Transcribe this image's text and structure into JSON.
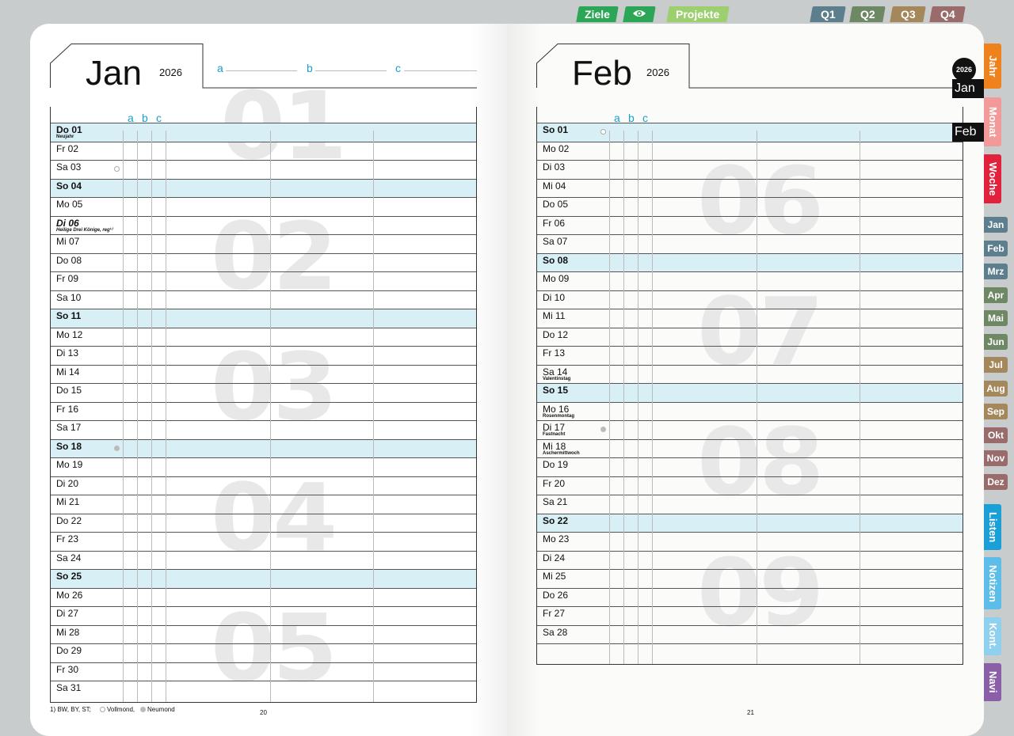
{
  "top_tabs": [
    {
      "label": "Ziele",
      "color": "#2aa656"
    },
    {
      "label": "",
      "icon": "eye-icon",
      "color": "#2aa656"
    },
    {
      "label": "Projekte",
      "color": "#9ccf6e"
    },
    {
      "label": "Q1",
      "color": "#5d7f8d"
    },
    {
      "label": "Q2",
      "color": "#6e8765"
    },
    {
      "label": "Q3",
      "color": "#a4875a"
    },
    {
      "label": "Q4",
      "color": "#9a6b6b"
    }
  ],
  "left": {
    "month": "Jan",
    "year": "2026",
    "abc": [
      "a",
      "b",
      "c"
    ],
    "columns": [
      "a",
      "b",
      "c"
    ],
    "week_numbers": [
      "01",
      "02",
      "03",
      "04",
      "05"
    ],
    "days": [
      {
        "label": "Do 01",
        "note": "Neujahr",
        "sun": true
      },
      {
        "label": "Fr 02"
      },
      {
        "label": "Sa 03",
        "moon": "full"
      },
      {
        "label": "So 04",
        "sun": true
      },
      {
        "label": "Mo 05"
      },
      {
        "label": "Di 06",
        "note": "Heilige Drei Könige, reg¹⁾",
        "bold": true
      },
      {
        "label": "Mi 07"
      },
      {
        "label": "Do 08"
      },
      {
        "label": "Fr 09"
      },
      {
        "label": "Sa 10"
      },
      {
        "label": "So 11",
        "sun": true
      },
      {
        "label": "Mo 12"
      },
      {
        "label": "Di 13"
      },
      {
        "label": "Mi 14"
      },
      {
        "label": "Do 15"
      },
      {
        "label": "Fr 16"
      },
      {
        "label": "Sa 17"
      },
      {
        "label": "So 18",
        "sun": true,
        "moon": "new"
      },
      {
        "label": "Mo 19"
      },
      {
        "label": "Di 20"
      },
      {
        "label": "Mi 21"
      },
      {
        "label": "Do 22"
      },
      {
        "label": "Fr 23"
      },
      {
        "label": "Sa 24"
      },
      {
        "label": "So 25",
        "sun": true
      },
      {
        "label": "Mo 26"
      },
      {
        "label": "Di 27"
      },
      {
        "label": "Mi 28"
      },
      {
        "label": "Do 29"
      },
      {
        "label": "Fr 30"
      },
      {
        "label": "Sa 31"
      }
    ],
    "footnote": "1) BW, BY, ST;",
    "legend_full": "Vollmond,",
    "legend_new": "Neumond",
    "page_number": "20"
  },
  "right": {
    "month": "Feb",
    "year": "2026",
    "columns": [
      "a",
      "b",
      "c"
    ],
    "week_numbers": [
      "06",
      "07",
      "08",
      "09"
    ],
    "days": [
      {
        "label": "So 01",
        "sun": true,
        "moon": "full"
      },
      {
        "label": "Mo 02"
      },
      {
        "label": "Di 03"
      },
      {
        "label": "Mi 04"
      },
      {
        "label": "Do 05"
      },
      {
        "label": "Fr 06"
      },
      {
        "label": "Sa 07"
      },
      {
        "label": "So 08",
        "sun": true
      },
      {
        "label": "Mo 09"
      },
      {
        "label": "Di 10"
      },
      {
        "label": "Mi 11"
      },
      {
        "label": "Do 12"
      },
      {
        "label": "Fr 13"
      },
      {
        "label": "Sa 14",
        "note": "Valentinstag"
      },
      {
        "label": "So 15",
        "sun": true
      },
      {
        "label": "Mo 16",
        "note": "Rosenmontag"
      },
      {
        "label": "Di 17",
        "note": "Fastnacht",
        "moon": "new"
      },
      {
        "label": "Mi 18",
        "note": "Aschermittwoch"
      },
      {
        "label": "Do 19"
      },
      {
        "label": "Fr 20"
      },
      {
        "label": "Sa 21"
      },
      {
        "label": "So 22",
        "sun": true
      },
      {
        "label": "Mo 23"
      },
      {
        "label": "Di 24"
      },
      {
        "label": "Mi 25"
      },
      {
        "label": "Do 26"
      },
      {
        "label": "Fr 27"
      },
      {
        "label": "Sa 28"
      },
      {
        "label": ""
      }
    ],
    "page_number": "21"
  },
  "side_nav": {
    "year_badge": "2026",
    "active_jan": "Jan",
    "active_feb": "Feb",
    "section_tabs": [
      {
        "label": "Jahr",
        "color": "#f0821e"
      },
      {
        "label": "Monat",
        "color": "#f29a9a"
      },
      {
        "label": "Woche",
        "color": "#e2213d"
      }
    ],
    "month_tabs": [
      {
        "label": "Jan",
        "color": "#5d7f8d"
      },
      {
        "label": "Feb",
        "color": "#5d7f8d"
      },
      {
        "label": "Mrz",
        "color": "#5d7f8d"
      },
      {
        "label": "Apr",
        "color": "#6e8765"
      },
      {
        "label": "Mai",
        "color": "#6e8765"
      },
      {
        "label": "Jun",
        "color": "#6e8765"
      },
      {
        "label": "Jul",
        "color": "#a4875a"
      },
      {
        "label": "Aug",
        "color": "#a4875a"
      },
      {
        "label": "Sep",
        "color": "#a4875a"
      },
      {
        "label": "Okt",
        "color": "#9a6b6b"
      },
      {
        "label": "Nov",
        "color": "#9a6b6b"
      },
      {
        "label": "Dez",
        "color": "#9a6b6b"
      }
    ],
    "bottom_tabs": [
      {
        "label": "Listen",
        "color": "#1a9fd6"
      },
      {
        "label": "Notizen",
        "color": "#5bbde8"
      },
      {
        "label": "Kont.",
        "color": "#8fd0ee"
      },
      {
        "label": "Navi",
        "color": "#8a5fa8"
      }
    ]
  }
}
